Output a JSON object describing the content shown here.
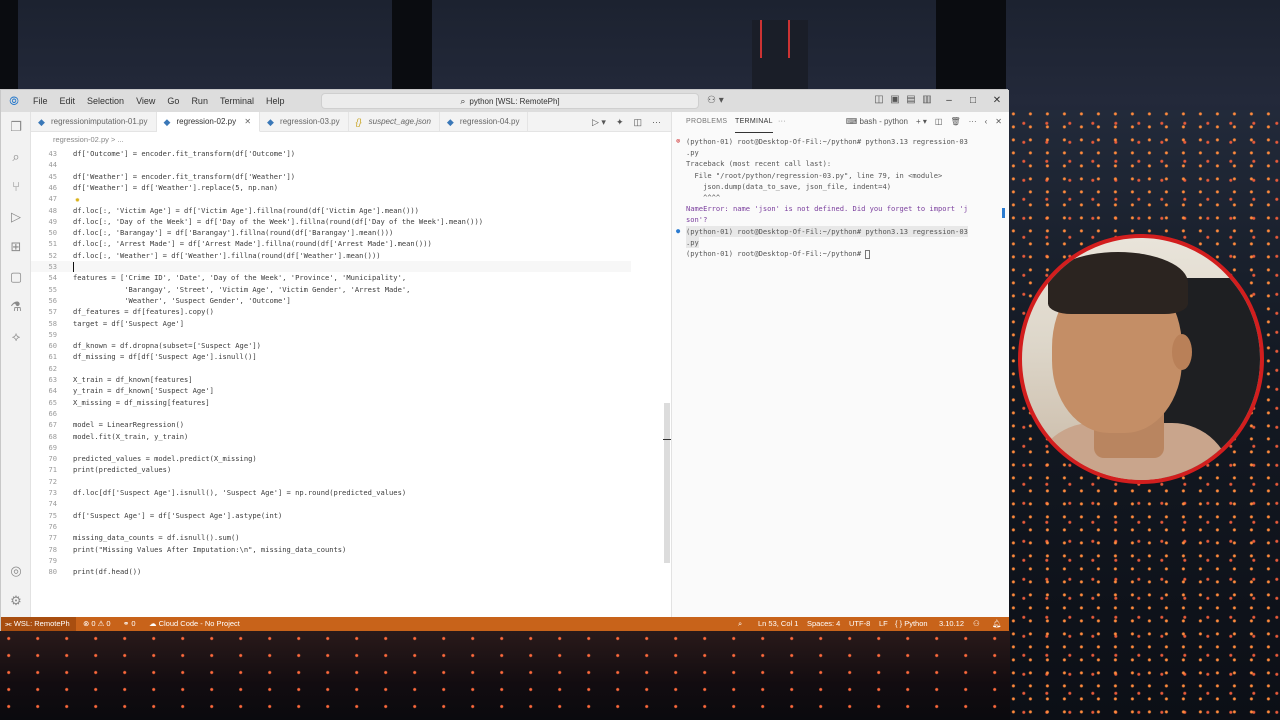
{
  "menu": [
    "File",
    "Edit",
    "Selection",
    "View",
    "Go",
    "Run",
    "Terminal",
    "Help"
  ],
  "command_center": "python [WSL: RemotePh]",
  "tabs": [
    {
      "label": "regressionimputation-01.py",
      "active": false
    },
    {
      "label": "regression-02.py",
      "active": true
    },
    {
      "label": "regression-03.py",
      "active": false
    },
    {
      "label": "suspect_age.json",
      "active": false
    },
    {
      "label": "regression-04.py",
      "active": false
    }
  ],
  "breadcrumb": "regression-02.py > ...",
  "code_lines": [
    {
      "n": "43",
      "t": "df['Outcome'] = encoder.fit_transform(df['Outcome'])"
    },
    {
      "n": "44",
      "t": ""
    },
    {
      "n": "45",
      "t": "df['Weather'] = encoder.fit_transform(df['Weather'])"
    },
    {
      "n": "46",
      "t": "df['Weather'] = df['Weather'].replace(5, np.nan)"
    },
    {
      "n": "47",
      "t": ""
    },
    {
      "n": "48",
      "t": "df.loc[:, 'Victim Age'] = df['Victim Age'].fillna(round(df['Victim Age'].mean()))"
    },
    {
      "n": "49",
      "t": "df.loc[:, 'Day of the Week'] = df['Day of the Week'].fillna(round(df['Day of the Week'].mean()))"
    },
    {
      "n": "50",
      "t": "df.loc[:, 'Barangay'] = df['Barangay'].fillna(round(df['Barangay'].mean()))"
    },
    {
      "n": "51",
      "t": "df.loc[:, 'Arrest Made'] = df['Arrest Made'].fillna(round(df['Arrest Made'].mean()))"
    },
    {
      "n": "52",
      "t": "df.loc[:, 'Weather'] = df['Weather'].fillna(round(df['Weather'].mean()))"
    },
    {
      "n": "53",
      "t": ""
    },
    {
      "n": "54",
      "t": "features = ['Crime ID', 'Date', 'Day of the Week', 'Province', 'Municipality',"
    },
    {
      "n": "55",
      "t": "            'Barangay', 'Street', 'Victim Age', 'Victim Gender', 'Arrest Made',"
    },
    {
      "n": "56",
      "t": "            'Weather', 'Suspect Gender', 'Outcome']"
    },
    {
      "n": "57",
      "t": "df_features = df[features].copy()"
    },
    {
      "n": "58",
      "t": "target = df['Suspect Age']"
    },
    {
      "n": "59",
      "t": ""
    },
    {
      "n": "60",
      "t": "df_known = df.dropna(subset=['Suspect Age'])"
    },
    {
      "n": "61",
      "t": "df_missing = df[df['Suspect Age'].isnull()]"
    },
    {
      "n": "62",
      "t": ""
    },
    {
      "n": "63",
      "t": "X_train = df_known[features]"
    },
    {
      "n": "64",
      "t": "y_train = df_known['Suspect Age']"
    },
    {
      "n": "65",
      "t": "X_missing = df_missing[features]"
    },
    {
      "n": "66",
      "t": ""
    },
    {
      "n": "67",
      "t": "model = LinearRegression()"
    },
    {
      "n": "68",
      "t": "model.fit(X_train, y_train)"
    },
    {
      "n": "69",
      "t": ""
    },
    {
      "n": "70",
      "t": "predicted_values = model.predict(X_missing)"
    },
    {
      "n": "71",
      "t": "print(predicted_values)"
    },
    {
      "n": "72",
      "t": ""
    },
    {
      "n": "73",
      "t": "df.loc[df['Suspect Age'].isnull(), 'Suspect Age'] = np.round(predicted_values)"
    },
    {
      "n": "74",
      "t": ""
    },
    {
      "n": "75",
      "t": "df['Suspect Age'] = df['Suspect Age'].astype(int)"
    },
    {
      "n": "76",
      "t": ""
    },
    {
      "n": "77",
      "t": "missing_data_counts = df.isnull().sum()"
    },
    {
      "n": "78",
      "t": "print(\"Missing Values After Imputation:\\n\", missing_data_counts)"
    },
    {
      "n": "79",
      "t": ""
    },
    {
      "n": "80",
      "t": "print(df.head())"
    }
  ],
  "panel": {
    "tab_problems": "PROBLEMS",
    "tab_terminal": "TERMINAL",
    "tab_more": "···",
    "shell": "bash - python",
    "terminal_lines": [
      {
        "dot": "red",
        "t": "(python-01) root@Desktop-Of-Fil:~/python# python3.13 regression-03"
      },
      {
        "dot": "",
        "t": ".py"
      },
      {
        "dot": "",
        "t": "Traceback (most recent call last):"
      },
      {
        "dot": "",
        "t": "  File \"/root/python/regression-03.py\", line 79, in <module>"
      },
      {
        "dot": "",
        "t": "    json.dump(data_to_save, json_file, indent=4)"
      },
      {
        "dot": "",
        "t": "    ^^^^"
      },
      {
        "dot": "",
        "t": "NameError: name 'json' is not defined. Did you forget to import 'j"
      },
      {
        "dot": "",
        "t": "son'?"
      },
      {
        "dot": "blue",
        "t": "(python-01) root@Desktop-Of-Fil:~/python# python3.13 regression-03"
      },
      {
        "dot": "",
        "t": ".py"
      },
      {
        "dot": "",
        "t": "(python-01) root@Desktop-Of-Fil:~/python# "
      }
    ]
  },
  "status": {
    "remote": "WSL: RemotePh",
    "problems": "⊗ 0 ⚠ 0",
    "ports": "⚭ 0",
    "cloud": "Cloud Code - No Project",
    "zoom_icon": "zoom-icon",
    "position": "Ln 53, Col 1",
    "spaces": "Spaces: 4",
    "encoding": "UTF-8",
    "eol": "LF",
    "language": "Python",
    "version": "3.10.12"
  },
  "colors": {
    "statusbar": "#c8631a",
    "webcam_border": "#d21e1e"
  }
}
